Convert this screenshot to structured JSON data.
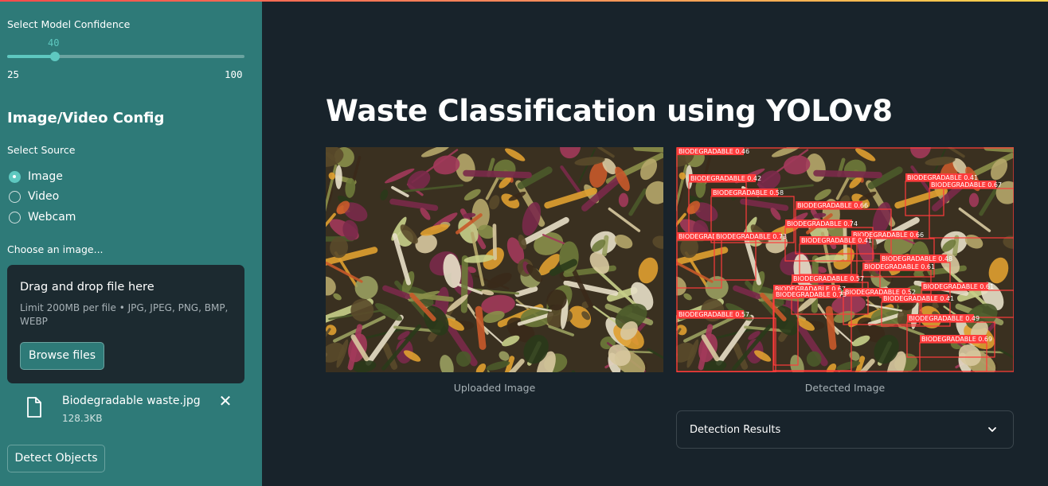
{
  "sidebar": {
    "confidence": {
      "label": "Select Model Confidence",
      "value": "40",
      "min": "25",
      "max": "100",
      "fraction": 0.2
    },
    "config_heading": "Image/Video Config",
    "source_label": "Select Source",
    "sources": [
      {
        "label": "Image",
        "selected": true
      },
      {
        "label": "Video",
        "selected": false
      },
      {
        "label": "Webcam",
        "selected": false
      }
    ],
    "chooser_label": "Choose an image...",
    "uploader": {
      "title": "Drag and drop file here",
      "limit": "Limit 200MB per file • JPG, JPEG, PNG, BMP, WEBP",
      "browse_label": "Browse files"
    },
    "file": {
      "name": "Biodegradable waste.jpg",
      "size": "128.3KB",
      "icon": "file-icon",
      "close_icon": "close-icon"
    },
    "detect_label": "Detect Objects"
  },
  "main": {
    "title": "Waste Classification using YOLOv8",
    "uploaded_caption": "Uploaded Image",
    "detected_caption": "Detected Image",
    "results_label": "Detection Results",
    "results_icon": "chevron-down-icon",
    "detections": [
      "BIODEGRADABLE 0.46",
      "BIODEGRADABLE 0.42",
      "BIODEGRADABLE 0.58",
      "BIODEGRADABLE 0.41",
      "BIODEGRADABLE 0.67",
      "BIODEGRADABLE 0.66",
      "BIODEGRADABLE 0.74",
      "BIODEGRADABLE 0.75",
      "BIODEGRADABLE 0.73",
      "BIODEGRADABLE 0.66",
      "BIODEGRADABLE 0.41",
      "BIODEGRADABLE 0.48",
      "BIODEGRADABLE 0.61",
      "BIODEGRADABLE 0.57",
      "BIODEGRADABLE 0.61",
      "BIODEGRADABLE 0.67",
      "BIODEGRADABLE 0.52",
      "BIODEGRADABLE 0.41",
      "BIODEGRADABLE 0.57",
      "BIODEGRADABLE 0.49",
      "BIODEGRADABLE 0.69",
      "BIODEGRADABLE 0.73"
    ]
  },
  "colors": {
    "sidebar_bg": "#2e7a78",
    "main_bg": "#18232b",
    "accent": "#5ec8c0",
    "detection_box": "#ff3b3b"
  }
}
